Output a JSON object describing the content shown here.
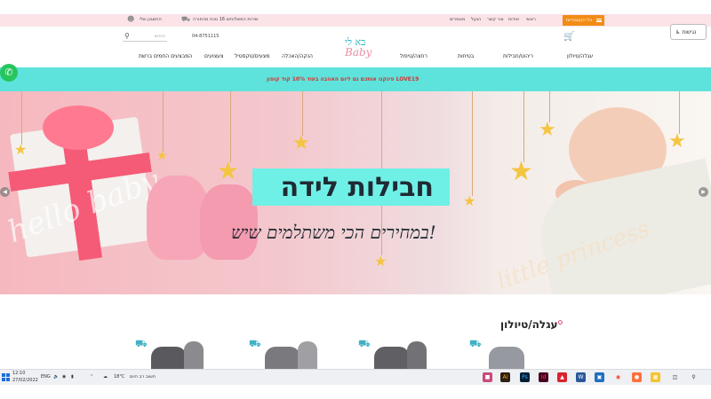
{
  "accessibility": {
    "label": "נגישות",
    "icon": "wheelchair-icon"
  },
  "topbar": {
    "categories_button": "כל הקטגוריות",
    "links": [
      "ראשי",
      "אודות",
      "צור קשר",
      "הנעל",
      "מאמרים"
    ],
    "delivery_text": "שירות המשלוחים 16 נוכח מהפורה",
    "account_text": "החשבון שלי"
  },
  "header": {
    "search_placeholder": "חיפוש",
    "phone": "04-8751115",
    "logo_hebrew": "בא לי",
    "logo_english": "Baby"
  },
  "nav": {
    "items": [
      "עגלה/טיולון",
      "ריהוט/חבילות",
      "בטיחות",
      "רחצה/טיפול",
      "הנקה/האכלה",
      "מצעים/טקסטיל",
      "צעצועים",
      "המבצעים החמים ברשת"
    ]
  },
  "promo": {
    "text": "פינקנו אותכם גם ליום האהבה בעוד 10% קוד קופון LOVE19"
  },
  "hero": {
    "title": "חבילות לידה",
    "subtitle": "במחירים הכי משתלמים שיש!",
    "script_left": "hello baby",
    "script_right": "little princess"
  },
  "section": {
    "title": "עגלה/טיולון"
  },
  "taskbar": {
    "time": "12:10",
    "date": "27/02/2022",
    "lang": "ENG",
    "weather": "18°C",
    "weather_label": "חשוב רב היום"
  },
  "colors": {
    "promo_bar": "#5ee3dc",
    "topbar": "#fbe3e8",
    "categories_button": "#f28c16",
    "promo_text": "#d73030",
    "title_box": "#6ff0e6",
    "whatsapp": "#27c65d"
  }
}
